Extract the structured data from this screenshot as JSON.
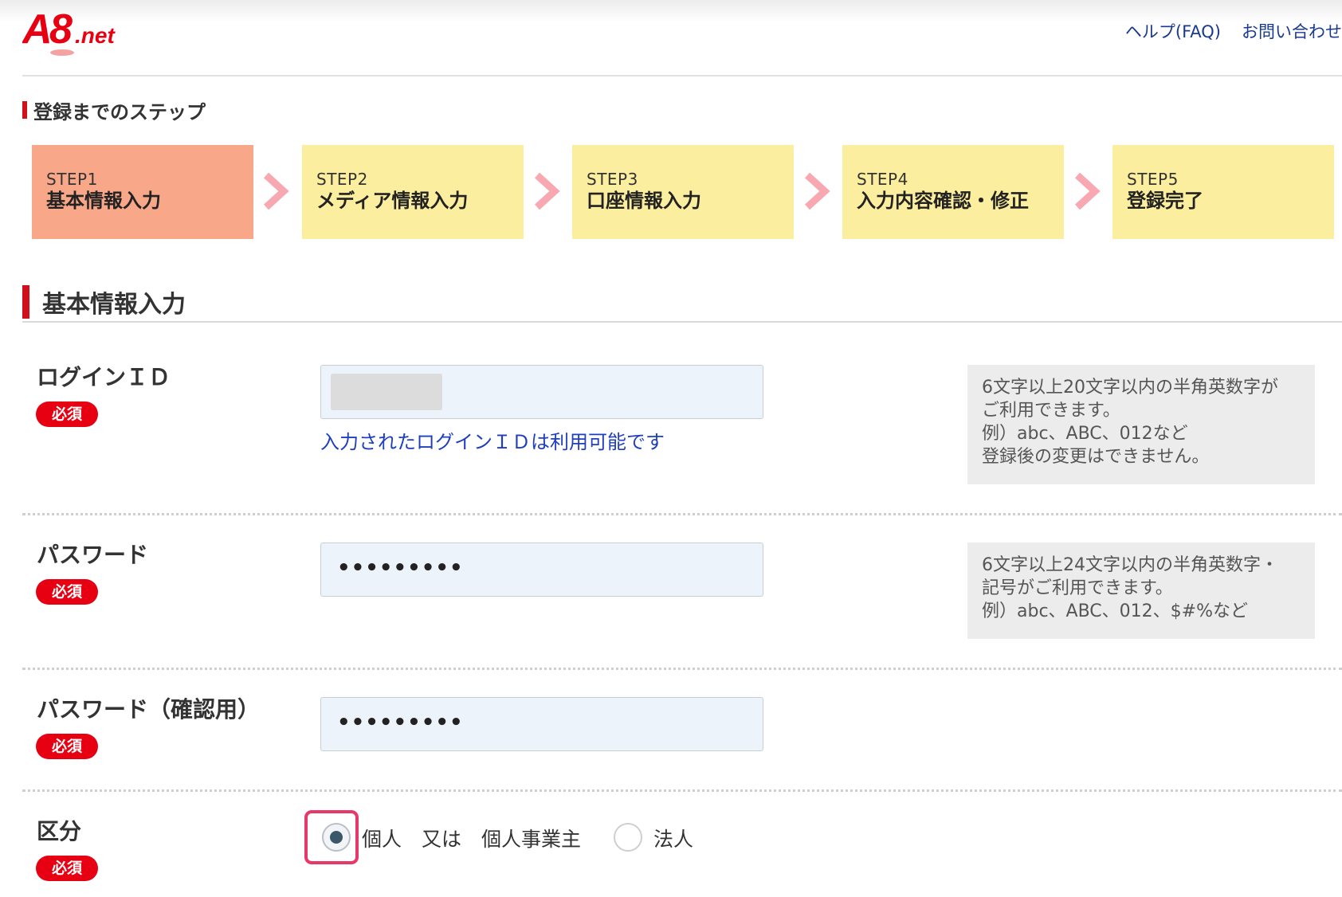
{
  "header": {
    "logo_text": "A8.net",
    "links": [
      "ヘルプ(FAQ)",
      "お問い合わせ"
    ]
  },
  "steps": {
    "title": "登録までのステップ",
    "items": [
      {
        "num": "STEP1",
        "label": "基本情報入力",
        "active": true
      },
      {
        "num": "STEP2",
        "label": "メディア情報入力",
        "active": false
      },
      {
        "num": "STEP3",
        "label": "口座情報入力",
        "active": false
      },
      {
        "num": "STEP4",
        "label": "入力内容確認・修正",
        "active": false
      },
      {
        "num": "STEP5",
        "label": "登録完了",
        "active": false
      }
    ]
  },
  "section": {
    "title": "基本情報入力"
  },
  "required_badge": "必須",
  "fields": {
    "login_id": {
      "label": "ログインＩＤ",
      "value": "",
      "status_message": "入力されたログインＩＤは利用可能です",
      "help": [
        "6文字以上20文字以内の半角英数字が",
        "ご利用できます。",
        "例）abc、ABC、012など",
        "登録後の変更はできません。"
      ]
    },
    "password": {
      "label": "パスワード",
      "value": "•••••••••",
      "help": [
        "6文字以上24文字以内の半角英数字・",
        "記号がご利用できます。",
        "例）abc、ABC、012、$#%など"
      ]
    },
    "password_confirm": {
      "label": "パスワード（確認用）",
      "value": "•••••••••"
    },
    "category": {
      "label": "区分",
      "options": [
        {
          "label": "個人　又は　個人事業主",
          "selected": true
        },
        {
          "label": "法人",
          "selected": false
        }
      ]
    }
  },
  "colors": {
    "brand_red": "#e60012",
    "step_active": "#f9a789",
    "step_inactive": "#fcee9f",
    "chevron": "#f7a8b0",
    "link_blue": "#1f3fbf",
    "highlight_border": "#e8386a"
  }
}
